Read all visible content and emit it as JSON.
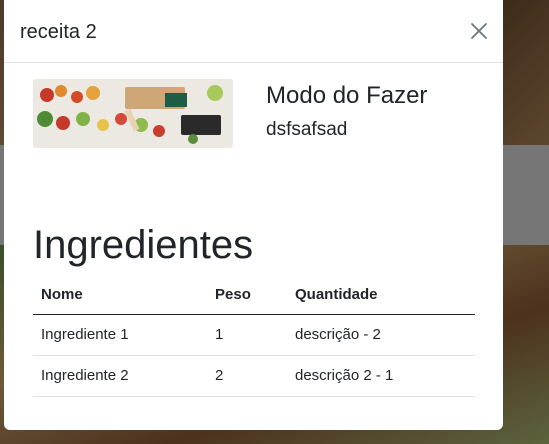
{
  "modal": {
    "title": "receita 2",
    "close_icon": "close-icon",
    "image_alt": "food-photo",
    "recipe": {
      "heading": "Modo do Fazer",
      "text": "dsfsafsad"
    },
    "ingredients": {
      "title": "Ingredientes",
      "columns": [
        "Nome",
        "Peso",
        "Quantidade"
      ],
      "rows": [
        [
          "Ingrediente 1",
          "1",
          "descrição - 2"
        ],
        [
          "Ingrediente 2",
          "2",
          "descrição 2 - 1"
        ]
      ]
    }
  },
  "colors": {
    "text": "#212529",
    "border": "#dee2e6",
    "backdrop": "rgba(0,0,0,0.45)"
  }
}
